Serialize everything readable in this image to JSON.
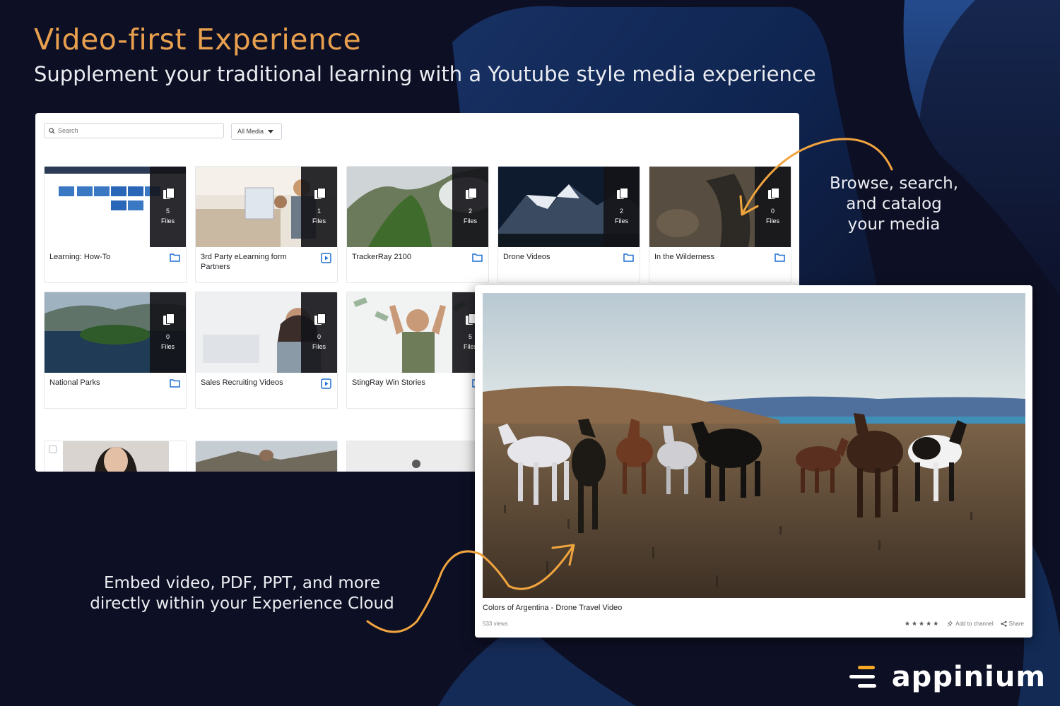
{
  "headline": "Video-first Experience",
  "subheadline": "Supplement your traditional learning with a Youtube style media experience",
  "toolbar": {
    "search_placeholder": "Search",
    "filter_label": "All Media"
  },
  "cards": [
    {
      "title": "Learning: How-To",
      "count": "5",
      "unit": "Files",
      "type": "folder"
    },
    {
      "title": "3rd Party eLearning form Partners",
      "count": "1",
      "unit": "Files",
      "type": "video"
    },
    {
      "title": "TrackerRay 2100",
      "count": "2",
      "unit": "Files",
      "type": "folder"
    },
    {
      "title": "Drone Videos",
      "count": "2",
      "unit": "Files",
      "type": "folder"
    },
    {
      "title": "In the Wilderness",
      "count": "0",
      "unit": "Files",
      "type": "folder"
    },
    {
      "title": "National Parks",
      "count": "0",
      "unit": "Files",
      "type": "folder"
    },
    {
      "title": "Sales Recruiting Videos",
      "count": "0",
      "unit": "Files",
      "type": "video"
    },
    {
      "title": "StingRay Win Stories",
      "count": "5",
      "unit": "Files",
      "type": "folder"
    }
  ],
  "player": {
    "title": "Colors of Argentina - Drone Travel Video",
    "views": "533 views",
    "rating_stars": "★★★★★",
    "add_to_channel": "Add to channel",
    "share": "Share"
  },
  "callouts": {
    "browse_line1": "Browse, search,",
    "browse_line2": "and catalog",
    "browse_line3": "your media",
    "embed_line1": "Embed video, PDF, PPT, and more",
    "embed_line2": "directly within your Experience Cloud"
  },
  "brand": {
    "name": "appinium",
    "accent_color": "#f5a623",
    "headline_color": "#e8a04e"
  }
}
